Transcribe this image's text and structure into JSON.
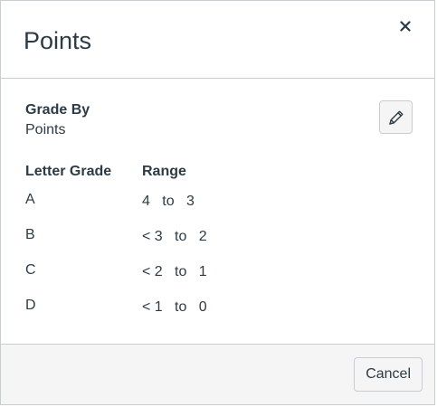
{
  "dialog": {
    "title": "Points",
    "close_icon": "close-icon"
  },
  "grade_by": {
    "heading": "Grade By",
    "value": "Points",
    "edit_icon": "pencil-icon"
  },
  "table": {
    "headers": {
      "letter": "Letter Grade",
      "range": "Range"
    },
    "rows": [
      {
        "letter": "A",
        "from": "4",
        "sep": "to",
        "to": "3"
      },
      {
        "letter": "B",
        "from": "< 3",
        "sep": "to",
        "to": "2"
      },
      {
        "letter": "C",
        "from": "< 2",
        "sep": "to",
        "to": "1"
      },
      {
        "letter": "D",
        "from": "< 1",
        "sep": "to",
        "to": "0"
      }
    ]
  },
  "footer": {
    "cancel_label": "Cancel"
  },
  "colors": {
    "text": "#2d3b45",
    "border": "#c7cdd1",
    "footer_bg": "#f5f5f5"
  }
}
